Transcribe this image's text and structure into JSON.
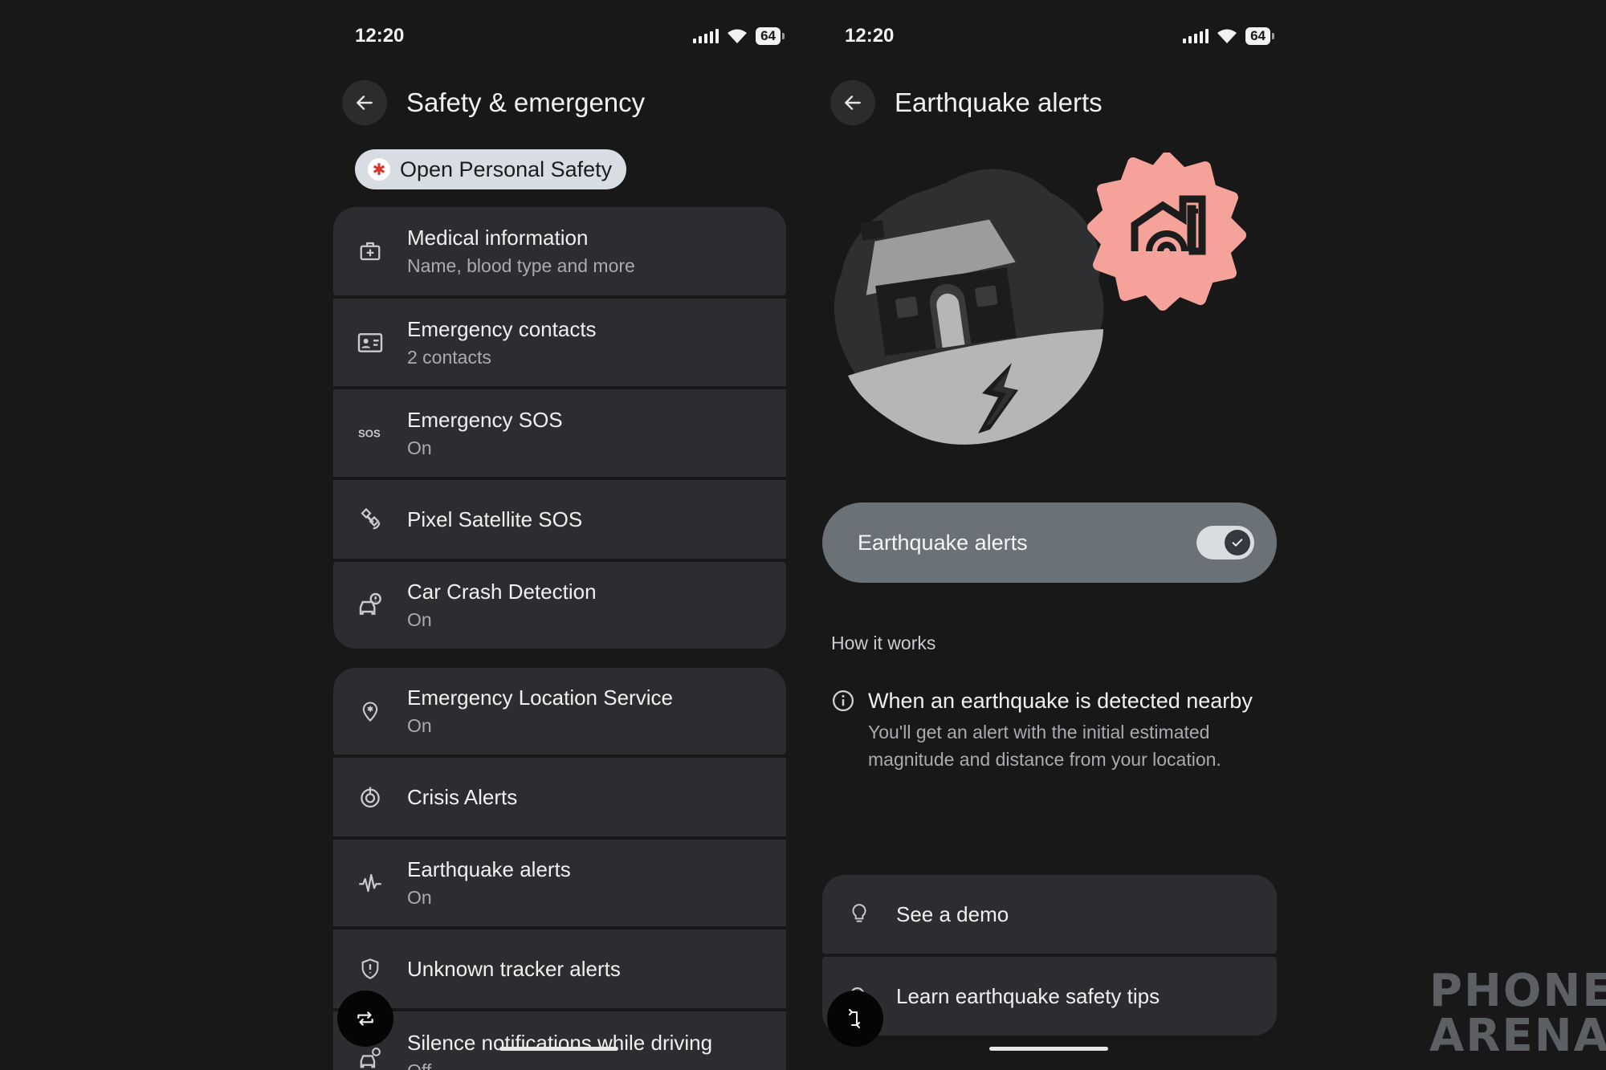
{
  "left": {
    "status": {
      "time": "12:20",
      "battery": "64"
    },
    "header": {
      "title": "Safety & emergency"
    },
    "chip": {
      "label": "Open Personal Safety"
    },
    "group1": [
      {
        "title": "Medical information",
        "subtitle": "Name, blood type and more",
        "icon": "medical-info-icon"
      },
      {
        "title": "Emergency contacts",
        "subtitle": "2 contacts",
        "icon": "contact-card-icon"
      },
      {
        "title": "Emergency SOS",
        "subtitle": "On",
        "icon": "sos-icon"
      },
      {
        "title": "Pixel Satellite SOS",
        "subtitle": "",
        "icon": "satellite-icon"
      },
      {
        "title": "Car Crash Detection",
        "subtitle": "On",
        "icon": "car-crash-icon"
      }
    ],
    "group2": [
      {
        "title": "Emergency Location Service",
        "subtitle": "On",
        "icon": "location-icon"
      },
      {
        "title": "Crisis Alerts",
        "subtitle": "",
        "icon": "crisis-icon"
      },
      {
        "title": "Earthquake alerts",
        "subtitle": "On",
        "icon": "seismic-icon"
      },
      {
        "title": "Unknown tracker alerts",
        "subtitle": "",
        "icon": "shield-icon"
      },
      {
        "title": "Silence notifications while driving",
        "subtitle": "Off",
        "icon": "car-icon"
      }
    ]
  },
  "right": {
    "status": {
      "time": "12:20",
      "battery": "64"
    },
    "header": {
      "title": "Earthquake alerts"
    },
    "toggle": {
      "label": "Earthquake alerts",
      "enabled": true
    },
    "section_label": "How it works",
    "info": {
      "title": "When an earthquake is detected nearby",
      "body": "You'll get an alert with the initial estimated magnitude and distance from your location."
    },
    "actions": [
      {
        "label": "See a demo",
        "icon": "lightbulb-icon"
      },
      {
        "label": "Learn earthquake safety tips",
        "icon": "search-icon"
      }
    ]
  },
  "watermark": {
    "line1": "PHONE",
    "line2": "ARENA"
  },
  "colors": {
    "background": "#181818",
    "card": "#2c2d30",
    "toggle_card": "#6b7277",
    "badge": "#f4a29a"
  }
}
